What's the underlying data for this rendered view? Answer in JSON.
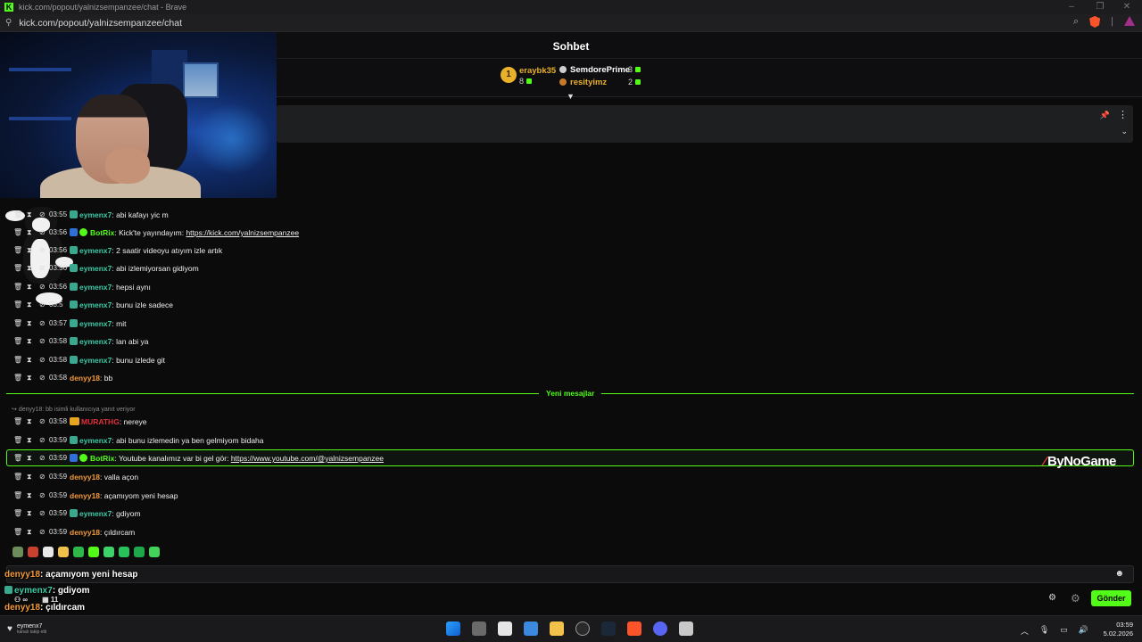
{
  "browser": {
    "window_title": "kick.com/popout/yalnizsempanzee/chat - Brave",
    "url": "kick.com/popout/yalnizsempanzee/chat"
  },
  "chat": {
    "header": "Sohbet",
    "top_gifters": [
      {
        "rank": "1",
        "name": "eraybk35",
        "count": "8",
        "color": "#e9b02a"
      },
      {
        "name": "SemdorePrime",
        "count": "3",
        "color": "#ffffff"
      },
      {
        "name": "resityimz",
        "count": "2",
        "color": "#e9b02a"
      }
    ],
    "new_messages_label": "Yeni mesajlar",
    "reply_context": "denyy18: bb isimli kullanıcıya yanıt veriyor",
    "messages": [
      {
        "time": "03:55",
        "user": "eymenx7",
        "user_color": "#3ec9a7",
        "text": "abi kafayı yic m"
      },
      {
        "time": "03:56",
        "user": "BotRix",
        "user_color": "#53fc18",
        "text": "Kick'te yayındayım: ",
        "link": "https://kick.com/yalnizsempanzee"
      },
      {
        "time": "03:56",
        "user": "eymenx7",
        "user_color": "#3ec9a7",
        "text": "2 saatir videoyu atıyım izle artık"
      },
      {
        "time": "03:56",
        "user": "eymenx7",
        "user_color": "#3ec9a7",
        "text": "abi izlemiyorsan gidiyom"
      },
      {
        "time": "03:56",
        "user": "eymenx7",
        "user_color": "#3ec9a7",
        "text": "hepsi aynı"
      },
      {
        "time": "03:5",
        "user": "eymenx7",
        "user_color": "#3ec9a7",
        "text": "bunu izle sadece"
      },
      {
        "time": "03:57",
        "user": "eymenx7",
        "user_color": "#3ec9a7",
        "text": "mit"
      },
      {
        "time": "03:58",
        "user": "eymenx7",
        "user_color": "#3ec9a7",
        "text": "lan abi ya"
      },
      {
        "time": "03:58",
        "user": "eymenx7",
        "user_color": "#3ec9a7",
        "text": "bunu izlede git"
      },
      {
        "time": "03:58",
        "user": "denyy18",
        "user_color": "#f39a3b",
        "text": "bb"
      },
      {
        "time": "03:58",
        "user": "MURATHG",
        "user_color": "#e02f3b",
        "text": "nereye"
      },
      {
        "time": "03:59",
        "user": "eymenx7",
        "user_color": "#3ec9a7",
        "text": "abi bunu izlemedin ya ben gelmiyom bidaha"
      },
      {
        "time": "03:59",
        "user": "BotRix",
        "user_color": "#53fc18",
        "text": "Youtube kanalımız var bi gel gör: ",
        "link": "https://www.youtube.com/@yalnizsempanzee"
      },
      {
        "time": "03:59",
        "user": "denyy18",
        "user_color": "#f39a3b",
        "text": "valla açon"
      },
      {
        "time": "03:59",
        "user": "denyy18",
        "user_color": "#f39a3b",
        "text": "açamıyom yeni hesap"
      },
      {
        "time": "03:59",
        "user": "eymenx7",
        "user_color": "#3ec9a7",
        "text": "gdiyom"
      },
      {
        "time": "03:59",
        "user": "denyy18",
        "user_color": "#f39a3b",
        "text": "çıldırcam"
      }
    ],
    "overlay_lines": [
      {
        "user": "denyy18",
        "color": "#f39a3b",
        "text": ": açamıyom yeni hesap"
      },
      {
        "user": "eymenx7",
        "color": "#3ec9a7",
        "text": ": gdiyom"
      },
      {
        "user": "denyy18",
        "color": "#f39a3b",
        "text": ": çıldırcam"
      }
    ],
    "overlay_counters": {
      "links": "∞",
      "count": "11"
    },
    "send_label": "Gönder",
    "sponsor": "ByNoGame",
    "accent": "#53fc18"
  },
  "taskbar": {
    "notification_user": "eymenx7",
    "notification_sub": "kanalı takip etti",
    "time": "03:59",
    "date": "5.02.2026"
  }
}
